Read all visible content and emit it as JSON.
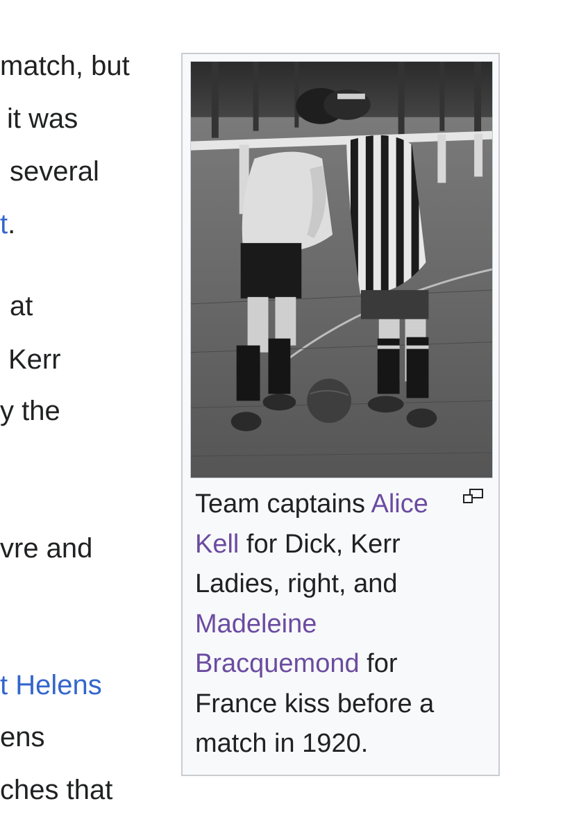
{
  "article_text": {
    "lines": [
      {
        "text": "match, but"
      },
      {
        "text": "it was"
      },
      {
        "text": "several"
      },
      {
        "text": "t",
        "link": true,
        "after": "."
      },
      {
        "text": "at"
      },
      {
        "text": "Kerr"
      },
      {
        "text": "y the"
      },
      {
        "text": "vre and"
      },
      {
        "text": "t Helens",
        "link": true
      },
      {
        "text": "ens"
      },
      {
        "text": "ches that"
      }
    ]
  },
  "thumbnail": {
    "image_alt": "Two football captains kissing before a match",
    "caption": {
      "intro": "Team captains ",
      "link1": "Alice Kell",
      "mid1": " for Dick, Kerr Ladies, right, and ",
      "link2": "Madeleine Bracquemond",
      "end": " for France kiss before a match in 1920."
    },
    "enlarge_icon": "magnify-clip-icon"
  },
  "colors": {
    "link": "#3366cc",
    "visited_link": "#6b4ba1",
    "text": "#202122",
    "thumb_bg": "#f8f9fa",
    "thumb_border": "#c8ccd1"
  }
}
